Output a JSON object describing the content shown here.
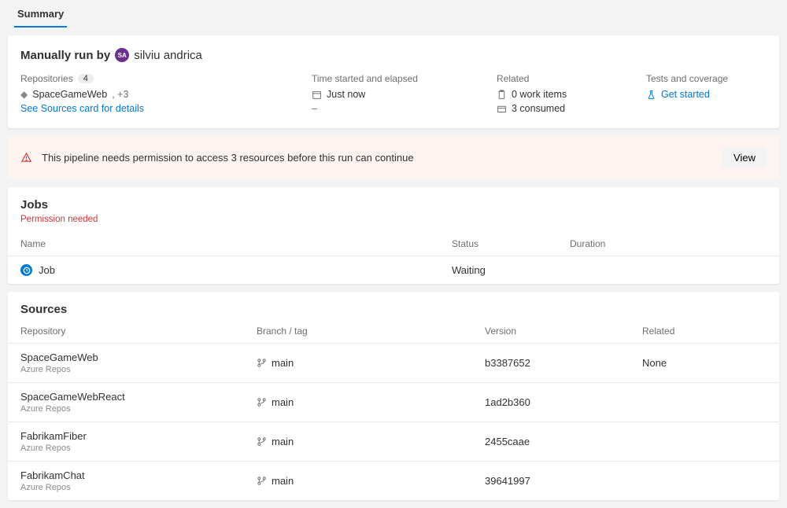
{
  "tabs": {
    "summary": "Summary"
  },
  "header": {
    "prefix": "Manually run by",
    "avatar_initials": "SA",
    "user_name": "silviu andrica",
    "repositories": {
      "label": "Repositories",
      "count": "4",
      "primary": "SpaceGameWeb",
      "extra": ", +3",
      "details_link": "See Sources card for details"
    },
    "time": {
      "label": "Time started and elapsed",
      "started": "Just now",
      "elapsed": "–"
    },
    "related": {
      "label": "Related",
      "work_items": "0 work items",
      "consumed": "3 consumed"
    },
    "tests": {
      "label": "Tests and coverage",
      "get_started": "Get started"
    }
  },
  "warning": {
    "text": "This pipeline needs permission to access 3 resources before this run can continue",
    "button": "View"
  },
  "jobs": {
    "title": "Jobs",
    "permission_needed": "Permission needed",
    "headers": {
      "name": "Name",
      "status": "Status",
      "duration": "Duration"
    },
    "rows": [
      {
        "name": "Job",
        "status": "Waiting",
        "duration": ""
      }
    ]
  },
  "sources": {
    "title": "Sources",
    "headers": {
      "repository": "Repository",
      "branch": "Branch / tag",
      "version": "Version",
      "related": "Related"
    },
    "rows": [
      {
        "name": "SpaceGameWeb",
        "sub": "Azure Repos",
        "branch": "main",
        "version": "b3387652",
        "related": "None"
      },
      {
        "name": "SpaceGameWebReact",
        "sub": "Azure Repos",
        "branch": "main",
        "version": "1ad2b360",
        "related": ""
      },
      {
        "name": "FabrikamFiber",
        "sub": "Azure Repos",
        "branch": "main",
        "version": "2455caae",
        "related": ""
      },
      {
        "name": "FabrikamChat",
        "sub": "Azure Repos",
        "branch": "main",
        "version": "39641997",
        "related": ""
      }
    ]
  }
}
